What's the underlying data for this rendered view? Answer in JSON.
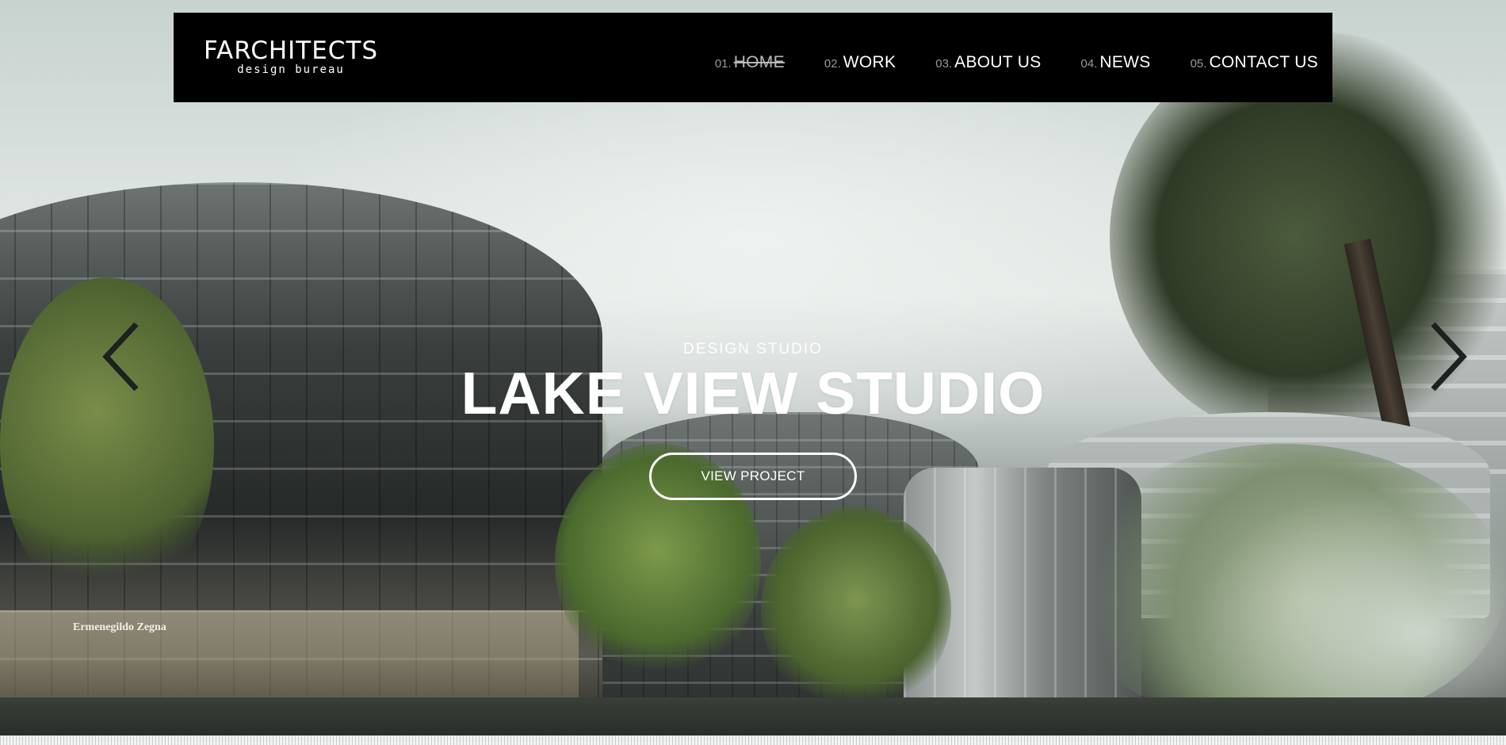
{
  "logo": {
    "main": "FARCHITECTS",
    "sub": "design bureau"
  },
  "nav": [
    {
      "num": "01.",
      "label": "HOME",
      "active": true
    },
    {
      "num": "02.",
      "label": "WORK"
    },
    {
      "num": "03.",
      "label": "ABOUT US"
    },
    {
      "num": "04.",
      "label": "NEWS"
    },
    {
      "num": "05.",
      "label": "CONTACT US"
    }
  ],
  "hero": {
    "eyebrow": "DESIGN STUDIO",
    "title": "LAKE VIEW STUDIO",
    "cta_label": "VIEW PROJECT",
    "store_sign": "Ermenegildo Zegna"
  },
  "carousel": {
    "prev_icon": "chevron-left-icon",
    "next_icon": "chevron-right-icon"
  },
  "colors": {
    "header_bg": "#000000",
    "text": "#ffffff",
    "nav_number": "#9a9a9a"
  }
}
